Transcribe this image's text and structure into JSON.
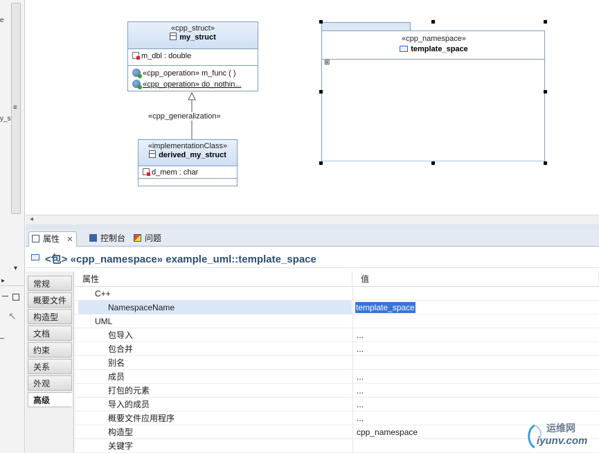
{
  "left_panel": {
    "fragment_a": "e",
    "fragment_b": "y_s"
  },
  "diagram": {
    "my_struct": {
      "stereotype": "«cpp_struct»",
      "name": "my_struct",
      "attributes": [
        "m_dbl : double"
      ],
      "operations": [
        "«cpp_operation» m_func ( )",
        "«cpp_operation» do_nothin..."
      ]
    },
    "generalization_label": "«cpp_generalization»",
    "derived": {
      "stereotype": "«implementationClass»",
      "name": "derived_my_struct",
      "attributes": [
        "d_mem : char"
      ]
    },
    "namespace": {
      "stereotype": "«cpp_namespace»",
      "name": "template_space",
      "expander": "⊞"
    }
  },
  "tabs": [
    {
      "label": "属性",
      "close": "✕",
      "active": true
    },
    {
      "label": "控制台",
      "active": false
    },
    {
      "label": "问题",
      "active": false
    }
  ],
  "properties": {
    "title": "<包> «cpp_namespace» example_uml::template_space",
    "categories": [
      "常规",
      "概要文件",
      "构造型",
      "文档",
      "约束",
      "关系",
      "外观",
      "高级"
    ],
    "selected_category": "高级",
    "columns": {
      "property": "属性",
      "value": "值"
    },
    "rows": [
      {
        "label": "C++",
        "value": "",
        "indent": 1
      },
      {
        "label": "NamespaceName",
        "value": "template_space",
        "indent": 2,
        "selected": true
      },
      {
        "label": "UML",
        "value": "",
        "indent": 1
      },
      {
        "label": "包导入",
        "value": "...",
        "indent": 2
      },
      {
        "label": "包合并",
        "value": "...",
        "indent": 2
      },
      {
        "label": "别名",
        "value": "",
        "indent": 2
      },
      {
        "label": "成员",
        "value": "...",
        "indent": 2
      },
      {
        "label": "打包的元素",
        "value": "...",
        "indent": 2
      },
      {
        "label": "导入的成员",
        "value": "...",
        "indent": 2
      },
      {
        "label": "概要文件应用程序",
        "value": "...",
        "indent": 2
      },
      {
        "label": "构造型",
        "value": "cpp_namespace",
        "indent": 2
      },
      {
        "label": "关键字",
        "value": "",
        "indent": 2
      }
    ]
  },
  "watermark": {
    "line1": "运维网",
    "line2": "iyunv.com"
  },
  "colors": {
    "accent": "#2b4e73",
    "selection": "#3875d7",
    "uml_border": "#7f9db9"
  }
}
